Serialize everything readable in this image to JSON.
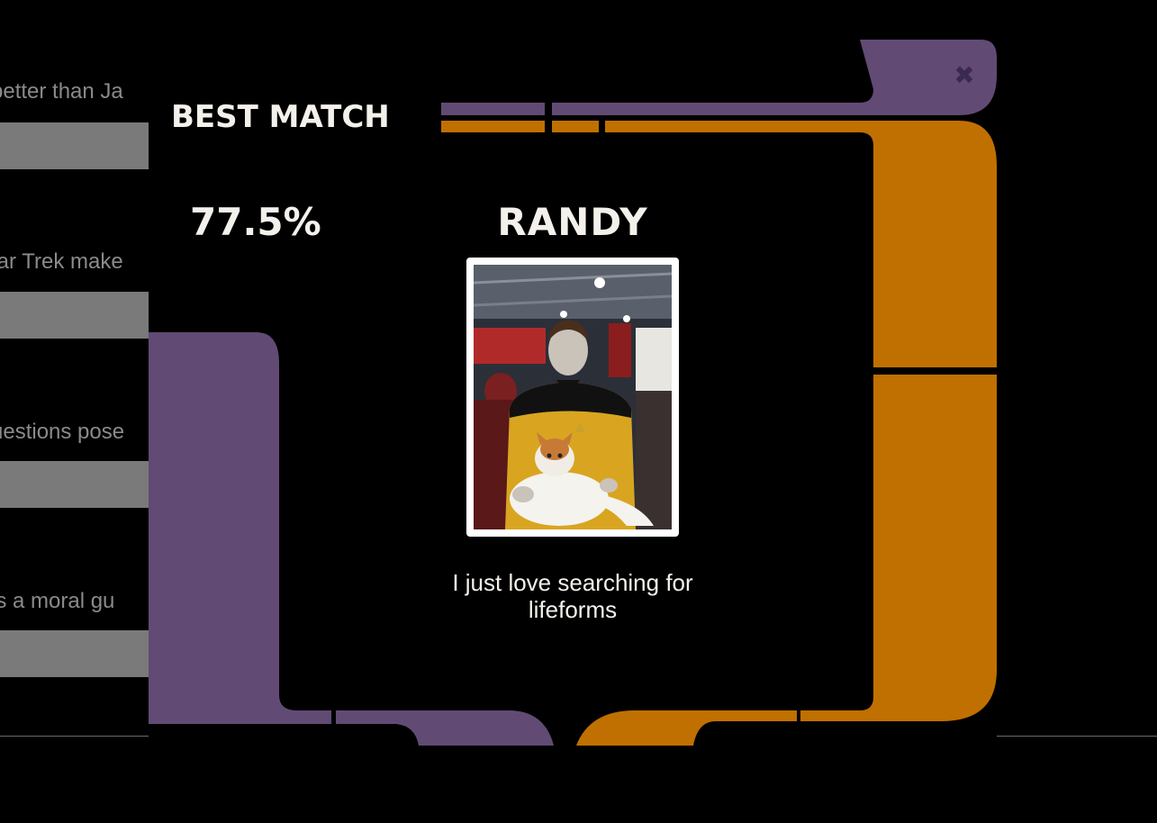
{
  "background_form": {
    "questions": [
      "better than Ja",
      "tar Trek make",
      "uestions pose",
      " is a moral gu"
    ]
  },
  "modal": {
    "title": "Best Match",
    "score": "77.5%",
    "match_name": "Randy",
    "photo_alt": "Randy photo",
    "bio": "I just love searching for lifeforms",
    "close_icon": "close-icon"
  },
  "colors": {
    "purple": "#614b75",
    "orange": "#c07000",
    "background": "#000000",
    "text": "#f4f1ec"
  }
}
